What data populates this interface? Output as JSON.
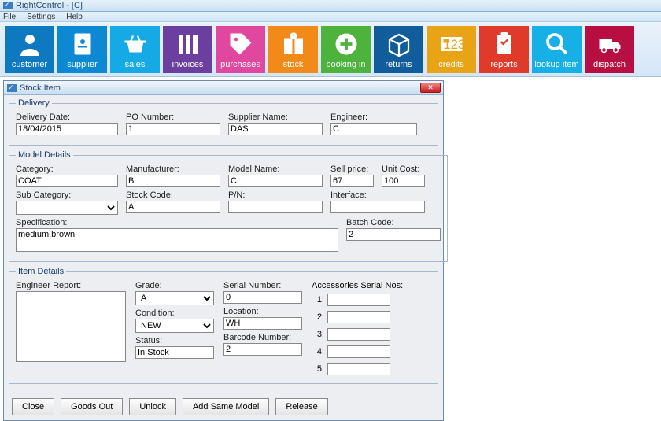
{
  "app": {
    "title": "RightControl - [C]"
  },
  "menu": [
    "File",
    "Settings",
    "Help"
  ],
  "toolbar": [
    {
      "key": "customer",
      "label": "customer"
    },
    {
      "key": "supplier",
      "label": "supplier"
    },
    {
      "key": "sales",
      "label": "sales"
    },
    {
      "key": "invoices",
      "label": "invoices"
    },
    {
      "key": "purchases",
      "label": "purchases"
    },
    {
      "key": "stock",
      "label": "stock"
    },
    {
      "key": "booking",
      "label": "booking in"
    },
    {
      "key": "returns",
      "label": "returns"
    },
    {
      "key": "credits",
      "label": "credits"
    },
    {
      "key": "reports",
      "label": "reports"
    },
    {
      "key": "lookup",
      "label": "lookup item"
    },
    {
      "key": "dispatch",
      "label": "dispatch"
    }
  ],
  "window": {
    "title": "Stock Item"
  },
  "delivery": {
    "legend": "Delivery",
    "date_label": "Delivery Date:",
    "date_value": "18/04/2015",
    "po_label": "PO Number:",
    "po_value": "1",
    "supplier_label": "Supplier Name:",
    "supplier_value": "DAS",
    "engineer_label": "Engineer:",
    "engineer_value": "C"
  },
  "model": {
    "legend": "Model Details",
    "category_label": "Category:",
    "category_value": "COAT",
    "manufacturer_label": "Manufacturer:",
    "manufacturer_value": "B",
    "modelname_label": "Model Name:",
    "modelname_value": "C",
    "sellprice_label": "Sell price:",
    "sellprice_value": "67",
    "unitcost_label": "Unit Cost:",
    "unitcost_value": "100",
    "subcat_label": "Sub Category:",
    "subcat_value": "",
    "stockcode_label": "Stock Code:",
    "stockcode_value": "A",
    "pn_label": "P/N:",
    "pn_value": "",
    "interface_label": "Interface:",
    "interface_value": "",
    "spec_label": "Specification:",
    "spec_value": "medium,brown",
    "batch_label": "Batch Code:",
    "batch_value": "2"
  },
  "item": {
    "legend": "Item Details",
    "engreport_label": "Engineer Report:",
    "engreport_value": "",
    "grade_label": "Grade:",
    "grade_value": "A",
    "condition_label": "Condition:",
    "condition_value": "NEW",
    "status_label": "Status:",
    "status_value": "In Stock",
    "serial_label": "Serial Number:",
    "serial_value": "0",
    "location_label": "Location:",
    "location_value": "WH",
    "barcode_label": "Barcode Number:",
    "barcode_value": "2",
    "acc_label": "Accessories Serial Nos:",
    "acc_rows": [
      "1:",
      "2:",
      "3:",
      "4:",
      "5:"
    ]
  },
  "buttons": {
    "close": "Close",
    "goods_out": "Goods Out",
    "unlock": "Unlock",
    "add_same": "Add Same Model",
    "release": "Release"
  }
}
